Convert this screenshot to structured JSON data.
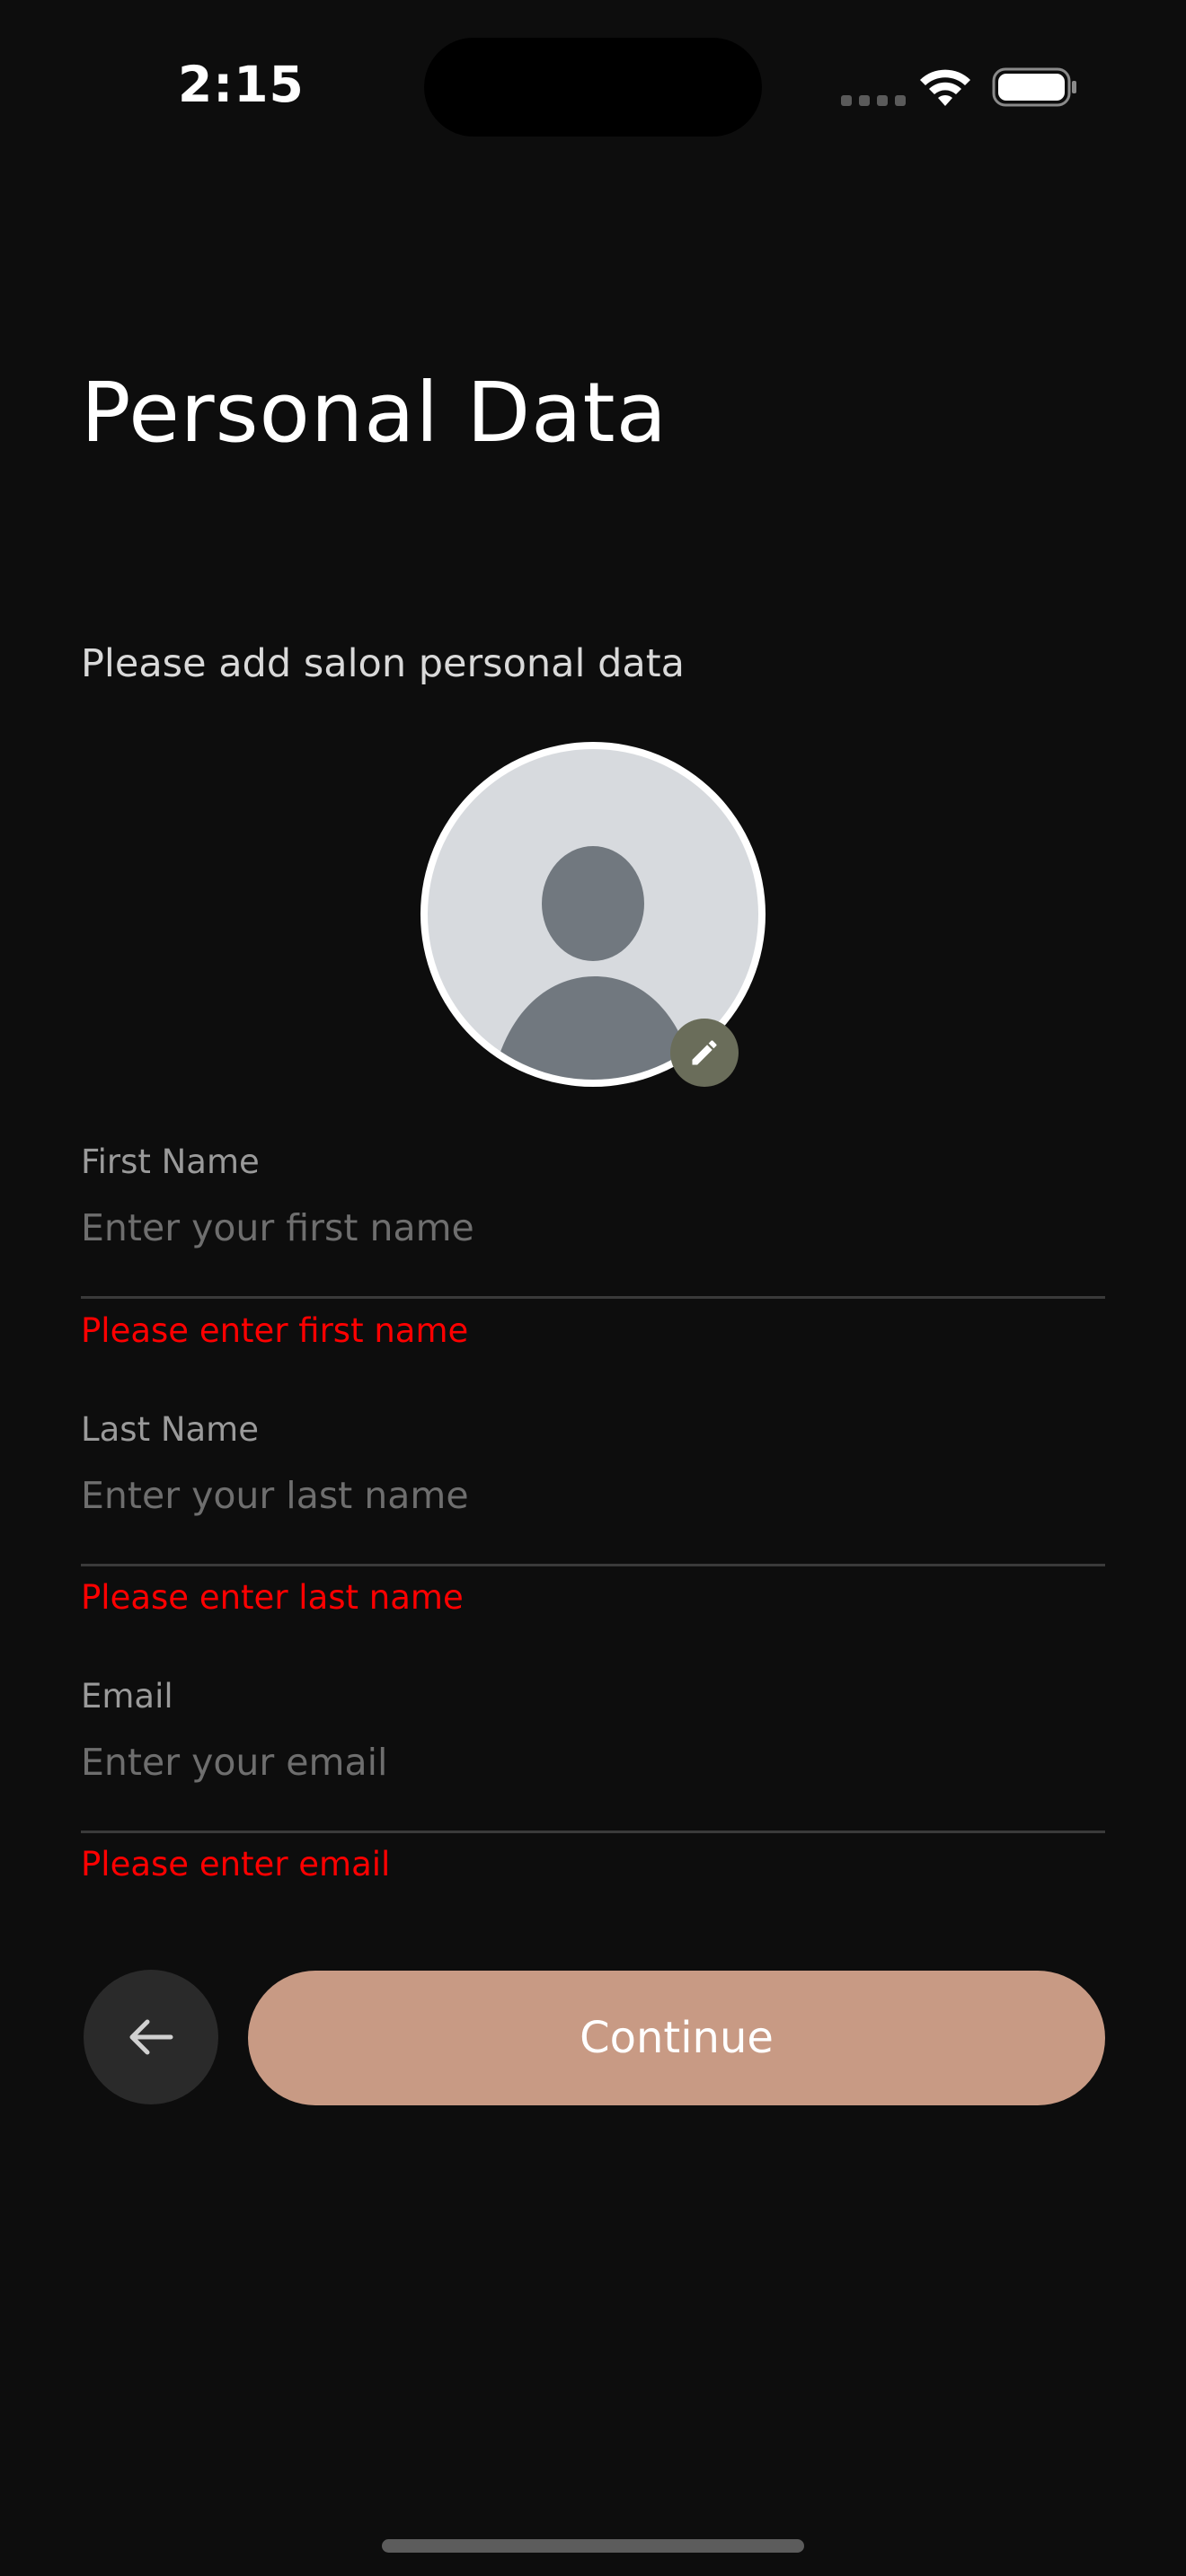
{
  "status_bar": {
    "time": "2:15"
  },
  "header": {
    "title": "Personal Data"
  },
  "subtitle": "Please add salon personal data",
  "avatar": {
    "icon": "person-placeholder-icon",
    "edit_icon": "pencil-icon"
  },
  "form": {
    "first_name": {
      "label": "First Name",
      "placeholder": "Enter your first name",
      "value": "",
      "error": "Please enter first name"
    },
    "last_name": {
      "label": "Last Name",
      "placeholder": "Enter your last name",
      "value": "",
      "error": "Please enter last name"
    },
    "email": {
      "label": "Email",
      "placeholder": "Enter your email",
      "value": "",
      "error": "Please enter email"
    }
  },
  "actions": {
    "back_icon": "arrow-left-icon",
    "continue_label": "Continue"
  },
  "colors": {
    "background": "#0d0d0d",
    "accent": "#c89a84",
    "error": "#ff0000",
    "edit_badge": "#6a6d5a"
  }
}
